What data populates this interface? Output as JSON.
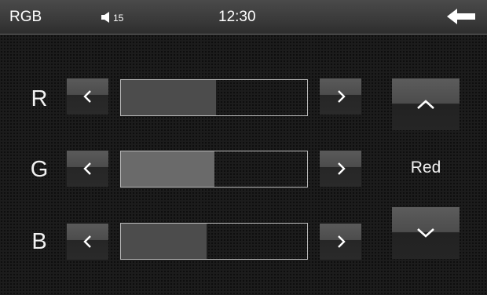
{
  "header": {
    "title": "RGB",
    "volume_level": "15",
    "clock": "12:30",
    "back_icon": "back-arrow-icon"
  },
  "channels": [
    {
      "label": "R",
      "level": 0.51
    },
    {
      "label": "G",
      "level": 0.5
    },
    {
      "label": "B",
      "level": 0.46
    }
  ],
  "selector": {
    "selected": "Red",
    "up_icon": "chevron-up-icon",
    "down_icon": "chevron-down-icon"
  },
  "colors": {
    "background": "#1c1c1c",
    "topbar": "#3a3a3a",
    "track_fill": "#4c4c4c",
    "track_fill_active": "#6a6a6a",
    "track_border": "#b8b8b8"
  }
}
